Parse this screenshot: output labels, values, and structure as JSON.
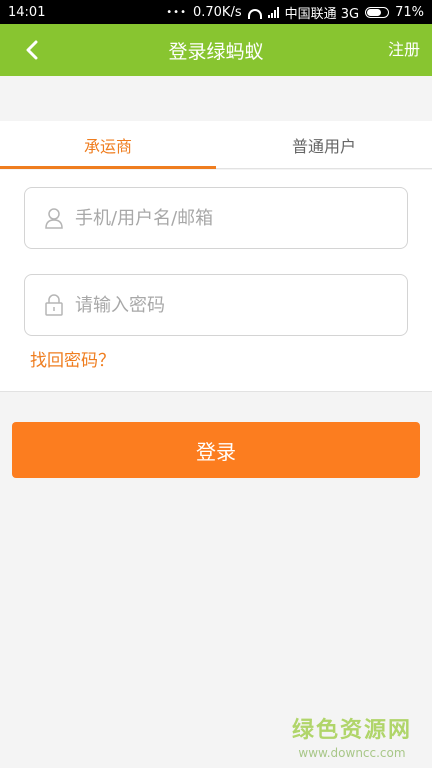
{
  "status_bar": {
    "time": "14:01",
    "dots": "•••",
    "speed": "0.70K/s",
    "carrier": "中国联通 3G",
    "battery_percent": "71%",
    "battery_level": 0.71
  },
  "header": {
    "title": "登录绿蚂蚁",
    "register_label": "注册",
    "color": "#88c530"
  },
  "tabs": [
    {
      "label": "承运商",
      "active": true
    },
    {
      "label": "普通用户",
      "active": false
    }
  ],
  "form": {
    "username_placeholder": "手机/用户名/邮箱",
    "username_value": "",
    "password_placeholder": "请输入密码",
    "password_value": "",
    "forgot_label": "找回密码？"
  },
  "login_button": {
    "label": "登录",
    "color": "#fc7d1f"
  },
  "watermark": {
    "title": "绿色资源网",
    "url": "www.downcc.com"
  },
  "icons": {
    "back": "chevron-left-icon",
    "user": "user-icon",
    "lock": "lock-icon",
    "wifi": "wifi-icon",
    "signal": "signal-icon",
    "battery": "battery-icon"
  }
}
